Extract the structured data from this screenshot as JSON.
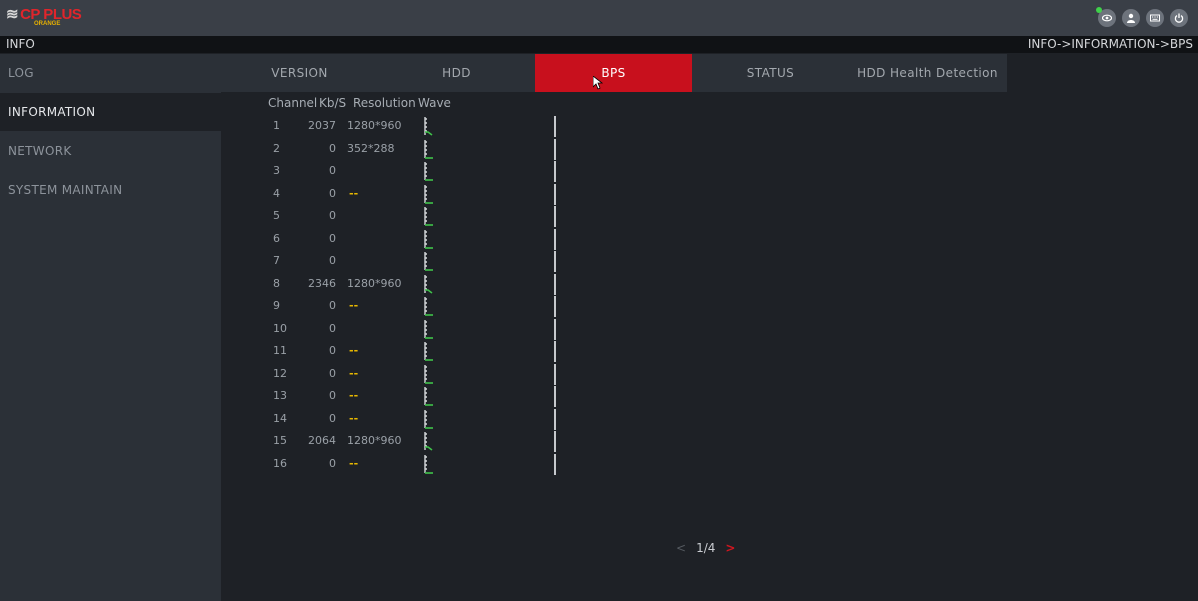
{
  "topbar": {
    "logo_main": "CP PLUS",
    "logo_sub": "ORANGE",
    "icons": [
      "live-view-icon",
      "account-icon",
      "keyboard-icon",
      "power-icon"
    ]
  },
  "infobar": {
    "title": "INFO",
    "breadcrumb": "INFO->INFORMATION->BPS"
  },
  "sidebar": {
    "items": [
      {
        "label": "LOG",
        "active": false
      },
      {
        "label": "INFORMATION",
        "active": true
      },
      {
        "label": "NETWORK",
        "active": false
      },
      {
        "label": "SYSTEM MAINTAIN",
        "active": false
      }
    ]
  },
  "tabs": [
    {
      "label": "VERSION",
      "active": false
    },
    {
      "label": "HDD",
      "active": false
    },
    {
      "label": "BPS",
      "active": true
    },
    {
      "label": "STATUS",
      "active": false
    },
    {
      "label": "HDD Health Detection",
      "active": false
    }
  ],
  "table": {
    "headers": {
      "channel": "Channel",
      "kbs": "Kb/S",
      "resolution": "Resolution",
      "wave": "Wave"
    },
    "rows": [
      {
        "ch": "1",
        "kbs": "2037",
        "res": "1280*960",
        "dash": "",
        "active": true
      },
      {
        "ch": "2",
        "kbs": "0",
        "res": "352*288",
        "dash": "",
        "active": false
      },
      {
        "ch": "3",
        "kbs": "0",
        "res": "",
        "dash": "",
        "active": false
      },
      {
        "ch": "4",
        "kbs": "0",
        "res": "",
        "dash": "--",
        "active": false
      },
      {
        "ch": "5",
        "kbs": "0",
        "res": "",
        "dash": "",
        "active": false
      },
      {
        "ch": "6",
        "kbs": "0",
        "res": "",
        "dash": "",
        "active": false
      },
      {
        "ch": "7",
        "kbs": "0",
        "res": "",
        "dash": "",
        "active": false
      },
      {
        "ch": "8",
        "kbs": "2346",
        "res": "1280*960",
        "dash": "",
        "active": true
      },
      {
        "ch": "9",
        "kbs": "0",
        "res": "",
        "dash": "--",
        "active": false
      },
      {
        "ch": "10",
        "kbs": "0",
        "res": "",
        "dash": "",
        "active": false
      },
      {
        "ch": "11",
        "kbs": "0",
        "res": "",
        "dash": "--",
        "active": false
      },
      {
        "ch": "12",
        "kbs": "0",
        "res": "",
        "dash": "--",
        "active": false
      },
      {
        "ch": "13",
        "kbs": "0",
        "res": "",
        "dash": "--",
        "active": false
      },
      {
        "ch": "14",
        "kbs": "0",
        "res": "",
        "dash": "--",
        "active": false
      },
      {
        "ch": "15",
        "kbs": "2064",
        "res": "1280*960",
        "dash": "",
        "active": true
      },
      {
        "ch": "16",
        "kbs": "0",
        "res": "",
        "dash": "--",
        "active": false
      }
    ]
  },
  "pager": {
    "prev": "<",
    "page": "1/4",
    "next": ">"
  },
  "colors": {
    "accent": "#c8101d",
    "dash": "#e8b800",
    "wave": "#3fc24a"
  }
}
